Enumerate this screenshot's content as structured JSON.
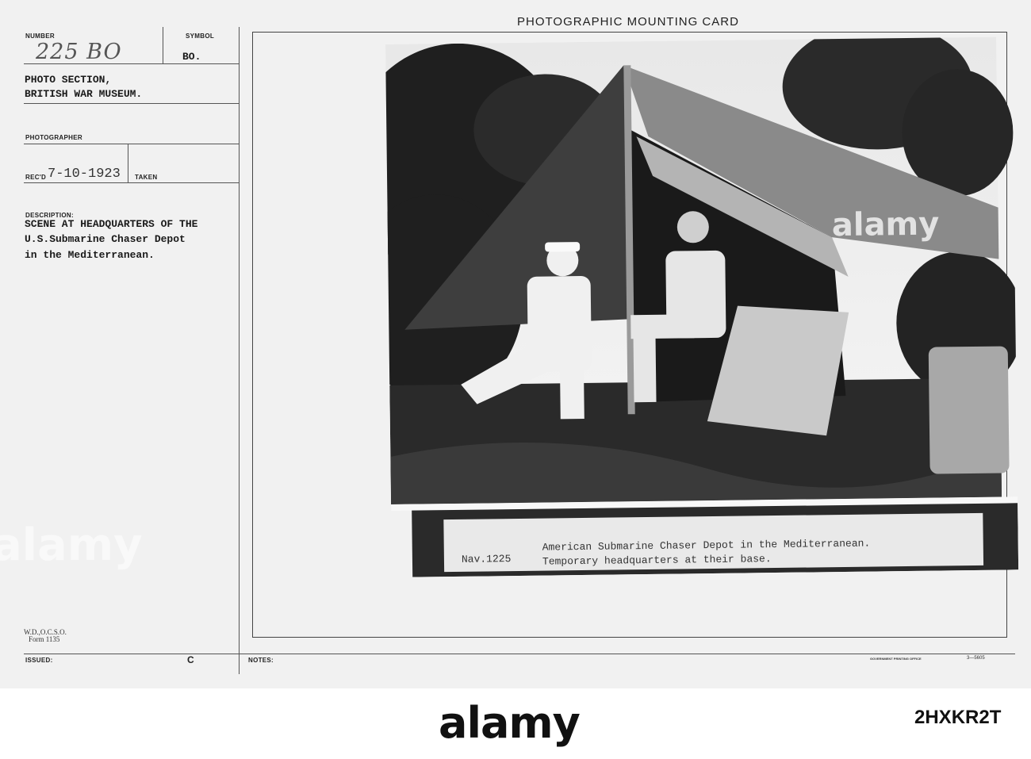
{
  "card": {
    "header_title": "PHOTOGRAPHIC MOUNTING CARD",
    "number_label": "NUMBER",
    "number_value": "225 BO",
    "symbol_label": "SYMBOL",
    "symbol_value": "BO.",
    "section_line1": "PHOTO SECTION,",
    "section_line2": "BRITISH WAR MUSEUM.",
    "photographer_label": "PHOTOGRAPHER",
    "recd_label": "REC'D",
    "recd_value": "7-10-1923",
    "taken_label": "TAKEN",
    "description_label": "DESCRIPTION:",
    "description_line1": "SCENE AT HEADQUARTERS OF THE",
    "description_line2": "U.S.Submarine Chaser Depot",
    "description_line3": "in the Mediterranean.",
    "form_line1": "W.D.,O.C.S.O.",
    "form_line2": "Form 1135",
    "issued_label": "ISSUED:",
    "issued_value": "C",
    "notes_label": "NOTES:",
    "printer_mark": "GOVERNMENT PRINTING OFFICE",
    "printer_code": "3—5605"
  },
  "photo": {
    "caption_number": "Nav.1225",
    "caption_line1": "American Submarine Chaser Depot in the Mediterranean.",
    "caption_line2": "Temporary headquarters at their base."
  },
  "watermarks": {
    "photo_mark": "alamy",
    "left_mark": "alamy"
  },
  "footer": {
    "logo": "alamy",
    "stock_id": "2HXKR2T"
  }
}
